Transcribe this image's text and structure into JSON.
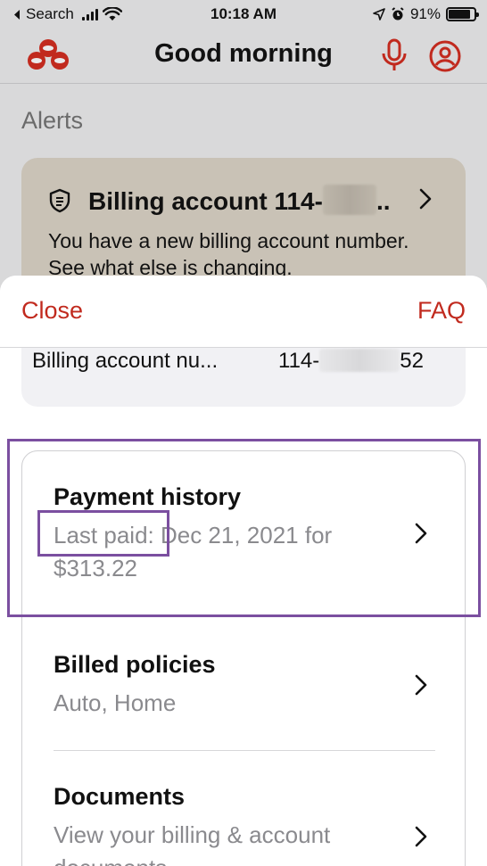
{
  "status_bar": {
    "back_label": "Search",
    "time": "10:18 AM",
    "battery_pct": "91%"
  },
  "header": {
    "title": "Good morning",
    "brand_color": "#c12a1e"
  },
  "alerts": {
    "heading": "Alerts",
    "card": {
      "title_prefix": "Billing account 114-",
      "title_suffix": "..",
      "body": "You have a new billing account number. See what else is changing."
    }
  },
  "sheet": {
    "close_label": "Close",
    "faq_label": "FAQ",
    "account": {
      "label": "Billing account nu...",
      "value_prefix": "114-",
      "value_suffix": "52"
    },
    "rows": [
      {
        "title": "Payment history",
        "subtitle_label": "Last paid:",
        "subtitle": " Dec 21, 2021 for $313.22"
      },
      {
        "title": "Billed policies",
        "subtitle": "Auto, Home"
      },
      {
        "title": "Documents",
        "subtitle": "View your billing & account documents"
      }
    ]
  },
  "icons": {
    "logo": "state-farm-logo-icon",
    "mic": "microphone-icon",
    "profile": "user-profile-icon",
    "shield": "shield-icon",
    "chevron": "chevron-right-icon"
  }
}
